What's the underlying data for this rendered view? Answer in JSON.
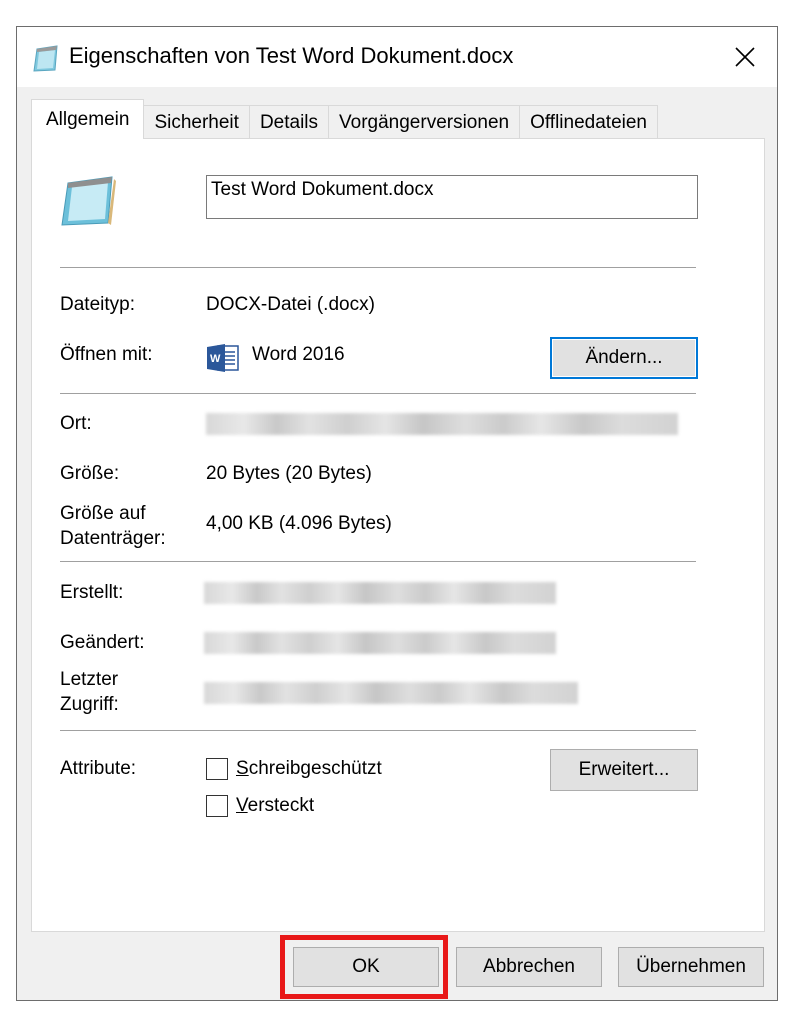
{
  "window": {
    "title": "Eigenschaften von Test Word Dokument.docx"
  },
  "tabs": [
    {
      "label": "Allgemein",
      "active": true
    },
    {
      "label": "Sicherheit",
      "active": false
    },
    {
      "label": "Details",
      "active": false
    },
    {
      "label": "Vorgängerversionen",
      "active": false
    },
    {
      "label": "Offlinedateien",
      "active": false
    }
  ],
  "general": {
    "file_name": "Test Word Dokument.docx",
    "type_label": "Dateityp:",
    "type_value": "DOCX-Datei (.docx)",
    "open_with_label": "Öffnen mit:",
    "open_with_value": "Word 2016",
    "change_button": "Ändern...",
    "location_label": "Ort:",
    "size_label": "Größe:",
    "size_value": "20 Bytes (20 Bytes)",
    "size_on_disk_label_1": "Größe auf",
    "size_on_disk_label_2": "Datenträger:",
    "size_on_disk_value": "4,00 KB (4.096 Bytes)",
    "created_label": "Erstellt:",
    "modified_label": "Geändert:",
    "accessed_label_1": "Letzter",
    "accessed_label_2": "Zugriff:",
    "attributes_label": "Attribute:",
    "readonly_label": "Schreibgeschützt",
    "hidden_label": "Versteckt",
    "advanced_button": "Erweitert..."
  },
  "footer": {
    "ok": "OK",
    "cancel": "Abbrechen",
    "apply": "Übernehmen"
  },
  "colors": {
    "accent": "#0078d7",
    "highlight": "#e81818",
    "word_blue": "#2b579a"
  }
}
